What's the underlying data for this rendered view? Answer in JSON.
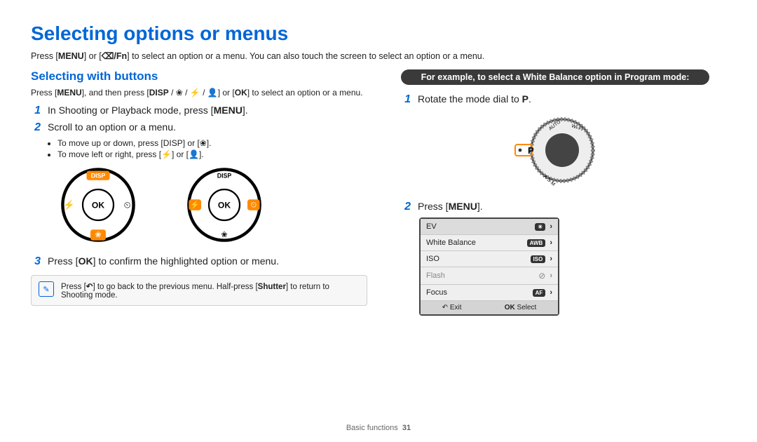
{
  "title": "Selecting options or menus",
  "intro_before": "Press [",
  "intro_btn1": "MENU",
  "intro_mid1": "] or [",
  "intro_btn2": "⌫/Fn",
  "intro_after": "] to select an option or a menu. You can also touch the screen to select an option or a menu.",
  "subheading": "Selecting with buttons",
  "smallnote_prefix": "Press [",
  "smallnote_b1": "MENU",
  "smallnote_mid": "], and then press [",
  "smallnote_b2": "DISP",
  "smallnote_b3": " / ❀ / ⚡ / 👤",
  "smallnote_mid2": "] or [",
  "smallnote_b4": "OK",
  "smallnote_after": "] to select an option or a menu.",
  "steps_left": {
    "s1_num": "1",
    "s1_pre": "In Shooting or Playback mode, press [",
    "s1_btn": "MENU",
    "s1_post": "].",
    "s2_num": "2",
    "s2_text": "Scroll to an option or a menu.",
    "s2_b1": "To move up or down, press [DISP] or [❀].",
    "s2_b2": "To move left or right, press [⚡] or [👤].",
    "s3_num": "3",
    "s3_pre": "Press [",
    "s3_btn": "OK",
    "s3_post": "] to confirm the highlighted option or menu."
  },
  "info": {
    "pre": "Press [",
    "btn": "↶",
    "mid": "] to go back to the previous menu. Half-press [",
    "bold": "Shutter",
    "post": "] to return to Shooting mode."
  },
  "dials": {
    "disp_active": "DISP",
    "disp_plain": "DISP",
    "ok": "OK"
  },
  "right": {
    "pill": "For example, to select a White Balance option in Program mode:",
    "s1_num": "1",
    "s1_pre": "Rotate the mode dial to ",
    "s1_btn": "P",
    "s1_post": ".",
    "s2_num": "2",
    "s2_pre": "Press [",
    "s2_btn": "MENU",
    "s2_post": "].",
    "menu": {
      "r1": "EV",
      "r1_icon": "✦",
      "r2": "White Balance",
      "r2_icon": "AWB",
      "r3": "ISO",
      "r3_icon": "ISO",
      "r4": "Flash",
      "r4_icon": "⚡",
      "r5": "Focus",
      "r5_icon": "AF",
      "exit_icon": "↶",
      "exit": "Exit",
      "sel_icon": "OK",
      "sel": "Select"
    },
    "mode_dial": {
      "p": "P",
      "auto": "AUTO",
      "wifi": "Wi-Fi",
      "asm": "A·S·M"
    }
  },
  "footer": {
    "section": "Basic functions",
    "page": "31"
  }
}
